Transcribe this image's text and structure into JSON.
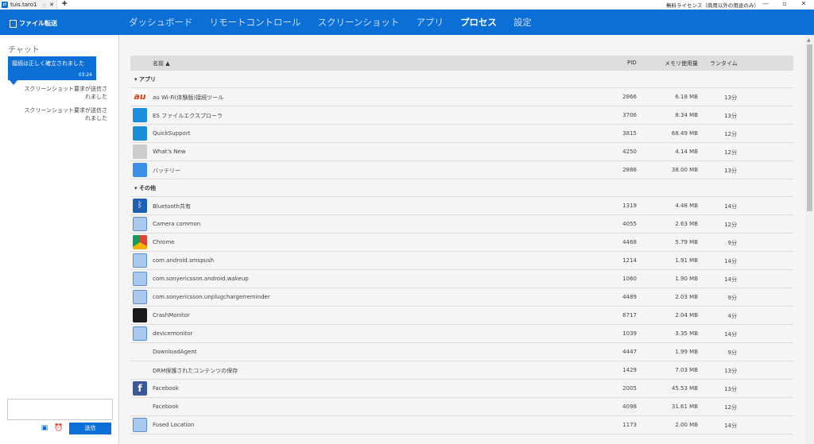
{
  "window": {
    "tab_title": "tuis.taro1",
    "tab_icon": "teamviewer-icon",
    "new_tab": "+",
    "license_text": "無料ライセンス（商用以外の用途のみ）",
    "controls": [
      "—",
      "▫",
      "✕"
    ]
  },
  "header": {
    "file_transfer": "ファイル転送",
    "nav": [
      {
        "label": "ダッシュボード",
        "active": false
      },
      {
        "label": "リモートコントロール",
        "active": false
      },
      {
        "label": "スクリーンショット",
        "active": false
      },
      {
        "label": "アプリ",
        "active": false
      },
      {
        "label": "プロセス",
        "active": true
      },
      {
        "label": "設定",
        "active": false
      }
    ]
  },
  "chat": {
    "title": "チャット",
    "bubble_text": "接続は正しく確立されました",
    "bubble_time": "03:24",
    "messages": [
      "スクリーンショット要求が送信されました",
      "スクリーンショット要求が送信されました"
    ],
    "input_value": "",
    "send_label": "送信"
  },
  "table": {
    "columns": {
      "name": "名前 ▲",
      "pid": "PID",
      "memory": "メモリ使用量",
      "runtime": "ランタイム"
    },
    "groups": [
      {
        "label": "▾ アプリ",
        "rows": [
          {
            "icon": "au-wifi-icon",
            "icon_class": "ic-au",
            "icon_text": "au",
            "name": "au Wi-Fi(体験版)接続ツール",
            "pid": "2866",
            "memory": "6.18 MB",
            "runtime": "13分"
          },
          {
            "icon": "es-file-explorer-icon",
            "icon_class": "ic-es",
            "icon_text": "",
            "name": "ES ファイルエクスプローラ",
            "pid": "3706",
            "memory": "8.34 MB",
            "runtime": "13分"
          },
          {
            "icon": "quicksupport-icon",
            "icon_class": "ic-qs",
            "icon_text": "",
            "name": "QuickSupport",
            "pid": "3815",
            "memory": "68.49 MB",
            "runtime": "12分"
          },
          {
            "icon": "whats-new-icon",
            "icon_class": "ic-wn",
            "icon_text": "",
            "name": "What's New",
            "pid": "4250",
            "memory": "4.14 MB",
            "runtime": "12分"
          },
          {
            "icon": "battery-icon",
            "icon_class": "ic-bat",
            "icon_text": "",
            "name": "バッテリー",
            "pid": "2886",
            "memory": "38.00 MB",
            "runtime": "13分"
          }
        ]
      },
      {
        "label": "▾ その他",
        "rows": [
          {
            "icon": "bluetooth-icon",
            "icon_class": "ic-bt",
            "icon_text": "ᛒ",
            "name": "Bluetooth共有",
            "pid": "1319",
            "memory": "4.48 MB",
            "runtime": "14分"
          },
          {
            "icon": "generic-app-icon",
            "icon_class": "ic-gen",
            "icon_text": "",
            "name": "Camera common",
            "pid": "4055",
            "memory": "2.63 MB",
            "runtime": "12分"
          },
          {
            "icon": "chrome-icon",
            "icon_class": "ic-chr",
            "icon_text": "",
            "name": "Chrome",
            "pid": "4468",
            "memory": "5.79 MB",
            "runtime": "9分"
          },
          {
            "icon": "generic-app-icon",
            "icon_class": "ic-gen",
            "icon_text": "",
            "name": "com.android.smspush",
            "pid": "1214",
            "memory": "1.91 MB",
            "runtime": "14分"
          },
          {
            "icon": "generic-app-icon",
            "icon_class": "ic-gen",
            "icon_text": "",
            "name": "com.sonyericsson.android.wakeup",
            "pid": "1060",
            "memory": "1.90 MB",
            "runtime": "14分"
          },
          {
            "icon": "generic-app-icon",
            "icon_class": "ic-gen",
            "icon_text": "",
            "name": "com.sonyericsson.unplugchargerreminder",
            "pid": "4489",
            "memory": "2.03 MB",
            "runtime": "9分"
          },
          {
            "icon": "crashmonitor-icon",
            "icon_class": "ic-crash",
            "icon_text": "",
            "name": "CrashMonitor",
            "pid": "6717",
            "memory": "2.04 MB",
            "runtime": "4分"
          },
          {
            "icon": "generic-app-icon",
            "icon_class": "ic-gen",
            "icon_text": "",
            "name": "devicemonitor",
            "pid": "1039",
            "memory": "3.35 MB",
            "runtime": "14分"
          },
          {
            "icon": "no-icon",
            "icon_class": "ic-none",
            "icon_text": "",
            "name": "DownloadAgent",
            "pid": "4447",
            "memory": "1.99 MB",
            "runtime": "9分"
          },
          {
            "icon": "no-icon",
            "icon_class": "ic-none",
            "icon_text": "",
            "name": "DRM保護されたコンテンツの保存",
            "pid": "1429",
            "memory": "7.03 MB",
            "runtime": "13分"
          },
          {
            "icon": "facebook-icon",
            "icon_class": "ic-fb",
            "icon_text": "f",
            "name": "Facebook",
            "pid": "2005",
            "memory": "45.53 MB",
            "runtime": "13分"
          },
          {
            "icon": "no-icon",
            "icon_class": "ic-none",
            "icon_text": "",
            "name": "Facebook",
            "pid": "4098",
            "memory": "31.61 MB",
            "runtime": "12分"
          },
          {
            "icon": "generic-app-icon",
            "icon_class": "ic-gen",
            "icon_text": "",
            "name": "Fused Location",
            "pid": "1173",
            "memory": "2.00 MB",
            "runtime": "14分"
          }
        ]
      }
    ]
  },
  "colors": {
    "accent": "#0b6fd6",
    "main_bg": "#f5f5f5",
    "header_row": "#dedede"
  }
}
